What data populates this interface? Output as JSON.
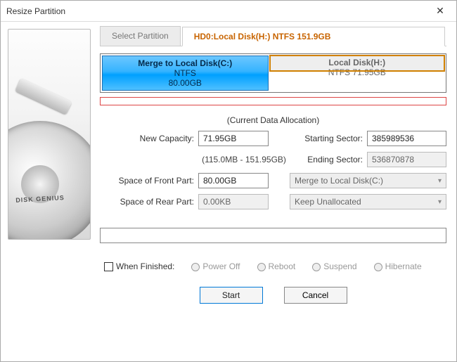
{
  "window": {
    "title": "Resize Partition"
  },
  "tabs": {
    "select": "Select Partition",
    "active": "HD0:Local Disk(H:) NTFS 151.9GB"
  },
  "partitions": {
    "p0": {
      "title": "Merge to Local Disk(C:)",
      "fs": "NTFS",
      "size": "80.00GB"
    },
    "p1": {
      "title": "Local Disk(H:)",
      "sub": "NTFS 71.95GB"
    }
  },
  "allocation_label": "(Current Data Allocation)",
  "labels": {
    "new_capacity": "New Capacity:",
    "starting_sector": "Starting Sector:",
    "ending_sector": "Ending Sector:",
    "space_front": "Space of Front Part:",
    "space_rear": "Space of Rear Part:",
    "when_finished": "When Finished:"
  },
  "values": {
    "new_capacity": "71.95GB",
    "range_hint": "(115.0MB - 151.95GB)",
    "starting_sector": "385989536",
    "ending_sector": "536870878",
    "space_front": "80.00GB",
    "front_target": "Merge to Local Disk(C:)",
    "space_rear": "0.00KB",
    "rear_target": "Keep Unallocated"
  },
  "finish_options": {
    "poweroff": "Power Off",
    "reboot": "Reboot",
    "suspend": "Suspend",
    "hibernate": "Hibernate"
  },
  "buttons": {
    "start": "Start",
    "cancel": "Cancel"
  },
  "sidebar_brand": "DISK GENIUS"
}
